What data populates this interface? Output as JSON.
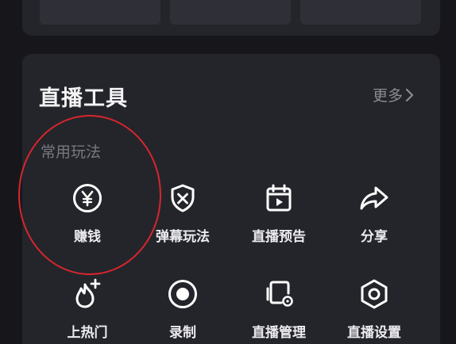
{
  "tools_card": {
    "title": "直播工具",
    "more_label": "更多",
    "section_label": "常用玩法",
    "tools": [
      {
        "label": "赚钱",
        "icon": "yuan-coin-icon"
      },
      {
        "label": "弹幕玩法",
        "icon": "shield-x-icon"
      },
      {
        "label": "直播预告",
        "icon": "calendar-play-icon"
      },
      {
        "label": "分享",
        "icon": "share-arrow-icon"
      },
      {
        "label": "上热门",
        "icon": "flame-plus-icon"
      },
      {
        "label": "录制",
        "icon": "record-icon"
      },
      {
        "label": "直播管理",
        "icon": "device-settings-icon"
      },
      {
        "label": "直播设置",
        "icon": "hexagon-settings-icon"
      }
    ]
  },
  "colors": {
    "background": "#17171b",
    "card": "#24252b",
    "tile": "#2f3037",
    "text_primary": "#f4f4f6",
    "text_secondary": "#8b8c93",
    "annotation": "#d7262c"
  }
}
